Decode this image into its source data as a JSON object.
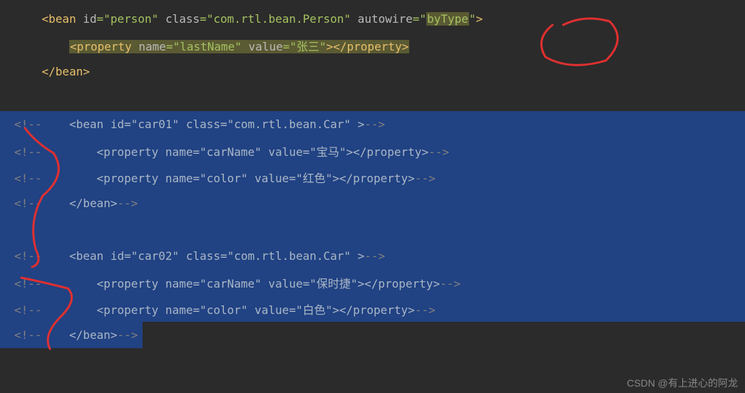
{
  "lines": {
    "l1": {
      "tag_open": "<bean",
      "attr1_name": " id",
      "attr1_eq": "=",
      "attr1_val": "\"person\"",
      "attr2_name": " class",
      "attr2_eq": "=",
      "attr2_val": "\"com.rtl.bean.Person\"",
      "attr3_name": " autowire",
      "attr3_eq": "=",
      "attr3_val_open": "\"",
      "attr3_val_hl": "byType",
      "attr3_val_close": "\"",
      "tag_close": ">"
    },
    "l2": {
      "prop_open": "<property",
      "attr1_name": " name",
      "attr1_eq": "=",
      "attr1_val": "\"lastName\"",
      "attr2_name": " value",
      "attr2_eq": "=",
      "attr2_val": "\"张三\"",
      "prop_mid": ">",
      "prop_close": "</property>"
    },
    "l3": {
      "close": "</bean>"
    },
    "l5": {
      "comment_open": "<!--",
      "content": "    <bean id=\"car01\" class=\"com.rtl.bean.Car\" >",
      "comment_close": "-->"
    },
    "l6": {
      "comment_open": "<!--",
      "content": "        <property name=\"carName\" value=\"宝马\"></property>",
      "comment_close": "-->"
    },
    "l7": {
      "comment_open": "<!--",
      "content": "        <property name=\"color\" value=\"红色\"></property>",
      "comment_close": "-->"
    },
    "l8": {
      "comment_open": "<!--",
      "content": "    </bean>",
      "comment_close": "-->"
    },
    "l10": {
      "comment_open": "<!--",
      "content": "    <bean id=\"car02\" class=\"com.rtl.bean.Car\" >",
      "comment_close": "-->"
    },
    "l11": {
      "comment_open": "<!--",
      "content": "        <property name=\"carName\" value=\"保时捷\"></property>",
      "comment_close": "-->"
    },
    "l12": {
      "comment_open": "<!--",
      "content": "        <property name=\"color\" value=\"白色\"></property>",
      "comment_close": "-->"
    },
    "l13": {
      "comment_open": "<!--",
      "content": "    </bean>",
      "comment_close": "-->"
    }
  },
  "watermark": "CSDN @有上进心的阿龙"
}
